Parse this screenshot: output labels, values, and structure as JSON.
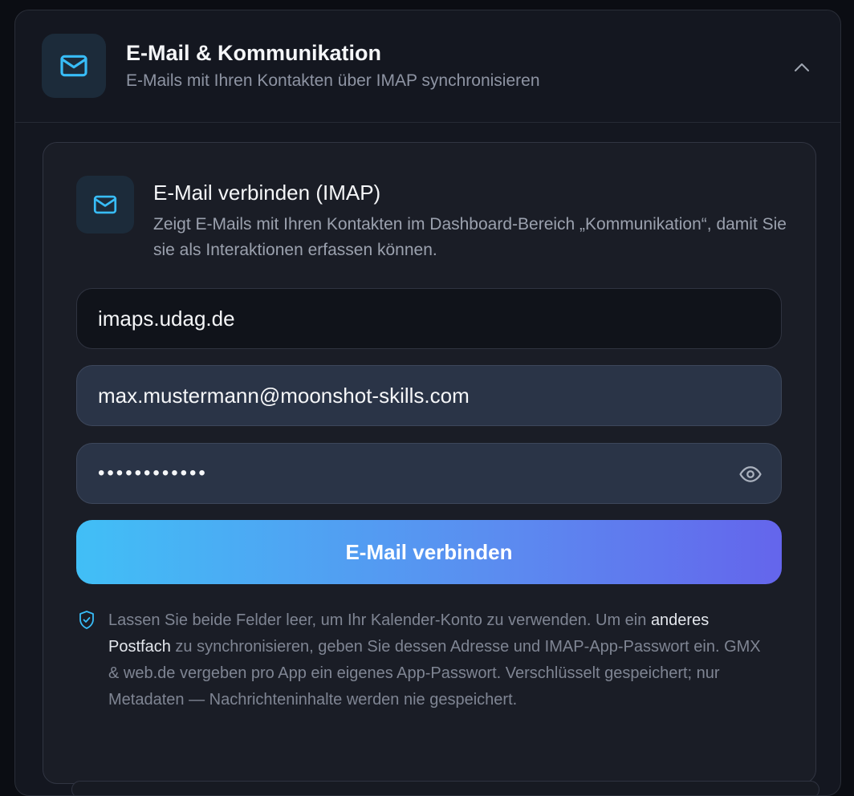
{
  "header": {
    "title": "E-Mail & Kommunikation",
    "subtitle": "E-Mails mit Ihren Kontakten über IMAP synchronisieren",
    "icon": "mail-icon",
    "collapse_icon": "chevron-up-icon"
  },
  "section": {
    "title": "E-Mail verbinden (IMAP)",
    "description": "Zeigt E-Mails mit Ihren Kontakten im Dashboard-Bereich „Kommunikation“, damit Sie sie als Interaktionen erfassen können.",
    "icon": "mail-icon"
  },
  "form": {
    "host_value": "imaps.udag.de",
    "email_value": "max.mustermann@moonshot-skills.com",
    "password_masked": "••••••••••••",
    "eye_icon": "eye-icon",
    "submit_label": "E-Mail verbinden"
  },
  "note": {
    "icon": "shield-check-icon",
    "text_before": "Lassen Sie beide Felder leer, um Ihr Kalender-Konto zu verwenden. Um ein ",
    "link_text": "anderes Postfach",
    "text_after": " zu synchronisieren, geben Sie dessen Adresse und IMAP-App-Passwort ein. GMX & web.de vergeben pro App ein eigenes App-Passwort. Verschlüsselt gespeichert; nur Metadaten — Nachrichteninhalte werden nie gespeichert."
  },
  "colors": {
    "accent": "#41bff6",
    "gradient_end": "#6465ec",
    "background": "#0b0d13"
  }
}
